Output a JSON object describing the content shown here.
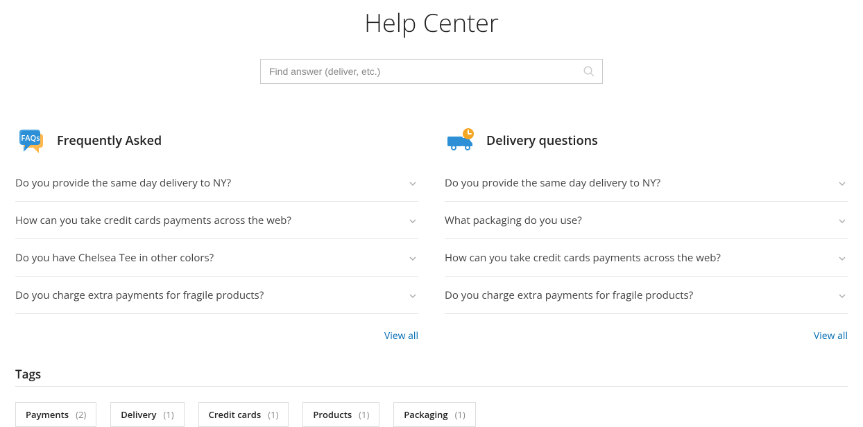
{
  "title": "Help Center",
  "search": {
    "placeholder": "Find answer (deliver, etc.)"
  },
  "columns": [
    {
      "id": "faq",
      "title": "Frequently Asked",
      "items": [
        "Do you provide the same day delivery to NY?",
        "How can you take credit cards payments across the web?",
        "Do you have Chelsea Tee in other colors?",
        "Do you charge extra payments for fragile products?"
      ],
      "view_all": "View all"
    },
    {
      "id": "delivery",
      "title": "Delivery questions",
      "items": [
        "Do you provide the same day delivery to NY?",
        "What packaging do you use?",
        "How can you take credit cards payments across the web?",
        "Do you charge extra payments for fragile products?"
      ],
      "view_all": "View all"
    }
  ],
  "tags_title": "Tags",
  "tags": [
    {
      "name": "Payments",
      "count": "(2)"
    },
    {
      "name": "Delivery",
      "count": "(1)"
    },
    {
      "name": "Credit cards",
      "count": "(1)"
    },
    {
      "name": "Products",
      "count": "(1)"
    },
    {
      "name": "Packaging",
      "count": "(1)"
    }
  ],
  "faqs_badge_text": "FAQs"
}
